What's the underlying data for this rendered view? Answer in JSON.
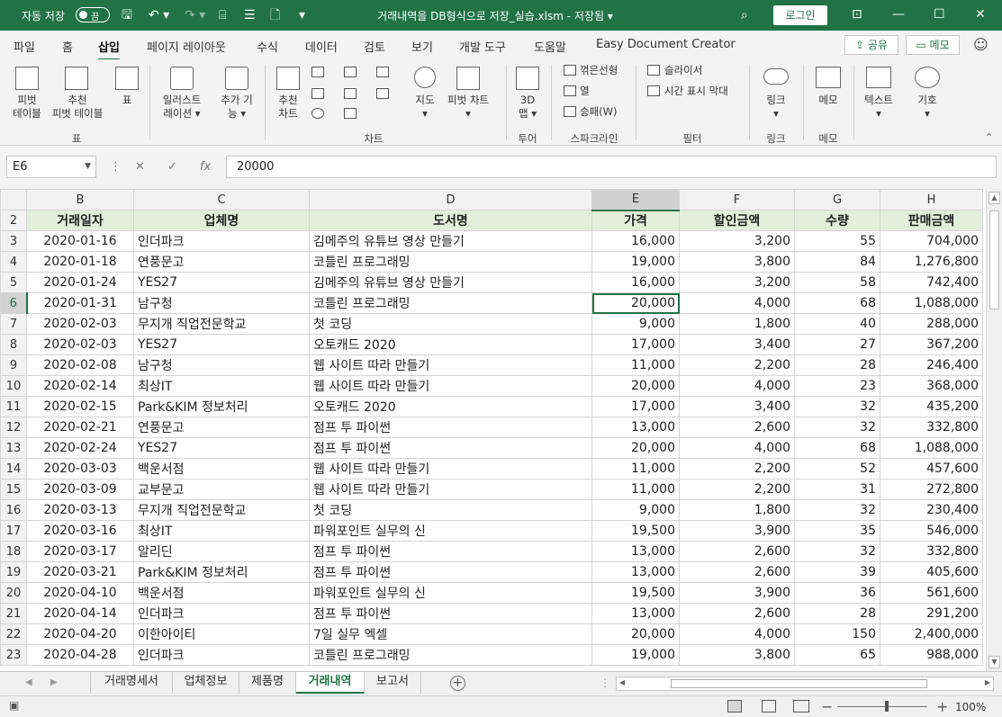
{
  "title_bar": {
    "autosave_label": "자동 저장",
    "autosave_state": "끔",
    "title": "거래내역을 DB형식으로 저장_실습.xlsm - 저장됨 ▾",
    "login_label": "로그인"
  },
  "ribbon_tabs": [
    "파일",
    "홈",
    "삽입",
    "페이지 레이아웃",
    "수식",
    "데이터",
    "검토",
    "보기",
    "개발 도구",
    "도움말",
    "Easy Document Creator"
  ],
  "active_tab": "삽입",
  "share_label": "공유",
  "comment_label": "메모",
  "ribbon": {
    "pivot_table": "피벗\n테이블",
    "recommended_pivot": "추천\n피벗 테이블",
    "table": "표",
    "illustrations": "일러스트\n레이션 ▾",
    "addins": "추가 기\n능 ▾",
    "recommended_charts": "추천\n차트",
    "maps": "지도\n▾",
    "pivot_chart": "피벗 차트\n▾",
    "map3d": "3D\n맵 ▾",
    "spark_line": "꺾은선형",
    "spark_column": "열",
    "spark_winloss": "승패(W)",
    "slicer": "슬라이서",
    "timeline": "시간 표시 막대",
    "link": "링크\n▾",
    "comment": "메모",
    "text": "텍스트\n▾",
    "symbols": "기호\n▾",
    "groups": {
      "tables": "표",
      "charts": "차트",
      "tours": "투어",
      "sparklines": "스파크라인",
      "filters": "필터",
      "links": "링크",
      "comments": "메모"
    }
  },
  "formula_bar": {
    "name_box": "E6",
    "formula": "20000"
  },
  "columns": [
    "B",
    "C",
    "D",
    "E",
    "F",
    "G",
    "H"
  ],
  "selected_column": "E",
  "selected_row": "6",
  "header_row": {
    "row": "2",
    "cells": [
      "거래일자",
      "업체명",
      "도서명",
      "가격",
      "할인금액",
      "수량",
      "판매금액"
    ]
  },
  "rows": [
    {
      "row": "3",
      "cells": [
        "2020-01-16",
        "인더파크",
        "김메주의 유튜브 영상 만들기",
        "16,000",
        "3,200",
        "55",
        "704,000"
      ]
    },
    {
      "row": "4",
      "cells": [
        "2020-01-18",
        "연풍문고",
        "코틀린 프로그래밍",
        "19,000",
        "3,800",
        "84",
        "1,276,800"
      ]
    },
    {
      "row": "5",
      "cells": [
        "2020-01-24",
        "YES27",
        "김메주의 유튜브 영상 만들기",
        "16,000",
        "3,200",
        "58",
        "742,400"
      ]
    },
    {
      "row": "6",
      "cells": [
        "2020-01-31",
        "남구청",
        "코틀린 프로그래밍",
        "20,000",
        "4,000",
        "68",
        "1,088,000"
      ]
    },
    {
      "row": "7",
      "cells": [
        "2020-02-03",
        "무지개 직업전문학교",
        "첫 코딩",
        "9,000",
        "1,800",
        "40",
        "288,000"
      ]
    },
    {
      "row": "8",
      "cells": [
        "2020-02-03",
        "YES27",
        "오토캐드 2020",
        "17,000",
        "3,400",
        "27",
        "367,200"
      ]
    },
    {
      "row": "9",
      "cells": [
        "2020-02-08",
        "남구청",
        "웹 사이트 따라 만들기",
        "11,000",
        "2,200",
        "28",
        "246,400"
      ]
    },
    {
      "row": "10",
      "cells": [
        "2020-02-14",
        "최상IT",
        "웹 사이트 따라 만들기",
        "20,000",
        "4,000",
        "23",
        "368,000"
      ]
    },
    {
      "row": "11",
      "cells": [
        "2020-02-15",
        "Park&KIM 정보처리",
        "오토캐드 2020",
        "17,000",
        "3,400",
        "32",
        "435,200"
      ]
    },
    {
      "row": "12",
      "cells": [
        "2020-02-21",
        "연풍문고",
        "점프 투 파이썬",
        "13,000",
        "2,600",
        "32",
        "332,800"
      ]
    },
    {
      "row": "13",
      "cells": [
        "2020-02-24",
        "YES27",
        "점프 투 파이썬",
        "20,000",
        "4,000",
        "68",
        "1,088,000"
      ]
    },
    {
      "row": "14",
      "cells": [
        "2020-03-03",
        "백운서점",
        "웹 사이트 따라 만들기",
        "11,000",
        "2,200",
        "52",
        "457,600"
      ]
    },
    {
      "row": "15",
      "cells": [
        "2020-03-09",
        "교부문고",
        "웹 사이트 따라 만들기",
        "11,000",
        "2,200",
        "31",
        "272,800"
      ]
    },
    {
      "row": "16",
      "cells": [
        "2020-03-13",
        "무지개 직업전문학교",
        "첫 코딩",
        "9,000",
        "1,800",
        "32",
        "230,400"
      ]
    },
    {
      "row": "17",
      "cells": [
        "2020-03-16",
        "최상IT",
        "파워포인트 실무의 신",
        "19,500",
        "3,900",
        "35",
        "546,000"
      ]
    },
    {
      "row": "18",
      "cells": [
        "2020-03-17",
        "알리딘",
        "점프 투 파이썬",
        "13,000",
        "2,600",
        "32",
        "332,800"
      ]
    },
    {
      "row": "19",
      "cells": [
        "2020-03-21",
        "Park&KIM 정보처리",
        "점프 투 파이썬",
        "13,000",
        "2,600",
        "39",
        "405,600"
      ]
    },
    {
      "row": "20",
      "cells": [
        "2020-04-10",
        "백운서점",
        "파워포인트 실무의 신",
        "19,500",
        "3,900",
        "36",
        "561,600"
      ]
    },
    {
      "row": "21",
      "cells": [
        "2020-04-14",
        "인더파크",
        "점프 투 파이썬",
        "13,000",
        "2,600",
        "28",
        "291,200"
      ]
    },
    {
      "row": "22",
      "cells": [
        "2020-04-20",
        "이한아이티",
        "7일 실무 엑셀",
        "20,000",
        "4,000",
        "150",
        "2,400,000"
      ]
    },
    {
      "row": "23",
      "cells": [
        "2020-04-28",
        "인더파크",
        "코틀린 프로그래밍",
        "19,000",
        "3,800",
        "65",
        "988,000"
      ]
    }
  ],
  "sheet_tabs": [
    "거래명세서",
    "업체정보",
    "제품명",
    "거래내역",
    "보고서"
  ],
  "active_sheet": "거래내역",
  "status_bar": {
    "zoom": "100%"
  },
  "colors": {
    "excel_green": "#217346",
    "header_fill": "#e2efda"
  }
}
